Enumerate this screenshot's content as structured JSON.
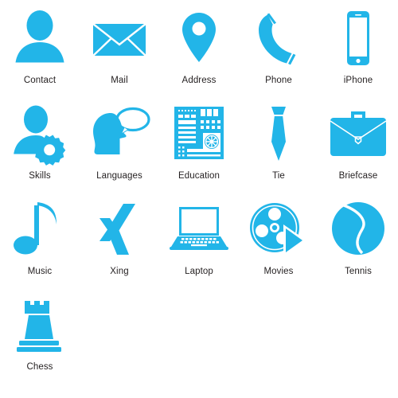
{
  "theme": {
    "icon_color": "#22b5e8",
    "label_color": "#231f20",
    "background_color": "#ffffff"
  },
  "sheet": {
    "columns": 5,
    "rows": 4,
    "total_icons": 16
  },
  "icons": [
    {
      "id": "contact",
      "label": "Contact",
      "glyph": "person-silhouette-icon"
    },
    {
      "id": "mail",
      "label": "Mail",
      "glyph": "envelope-icon"
    },
    {
      "id": "address",
      "label": "Address",
      "glyph": "map-pin-icon"
    },
    {
      "id": "phone",
      "label": "Phone",
      "glyph": "telephone-handset-icon"
    },
    {
      "id": "iphone",
      "label": "iPhone",
      "glyph": "smartphone-icon"
    },
    {
      "id": "skills",
      "label": "Skills",
      "glyph": "person-gear-icon"
    },
    {
      "id": "languages",
      "label": "Languages",
      "glyph": "head-speech-bubble-icon"
    },
    {
      "id": "education",
      "label": "Education",
      "glyph": "circuit-board-icon"
    },
    {
      "id": "tie",
      "label": "Tie",
      "glyph": "necktie-icon"
    },
    {
      "id": "briefcase",
      "label": "Briefcase",
      "glyph": "briefcase-icon"
    },
    {
      "id": "music",
      "label": "Music",
      "glyph": "music-note-icon"
    },
    {
      "id": "xing",
      "label": "Xing",
      "glyph": "xing-logo-icon"
    },
    {
      "id": "laptop",
      "label": "Laptop",
      "glyph": "laptop-icon"
    },
    {
      "id": "movies",
      "label": "Movies",
      "glyph": "film-reel-play-icon"
    },
    {
      "id": "tennis",
      "label": "Tennis",
      "glyph": "tennis-ball-icon"
    },
    {
      "id": "chess",
      "label": "Chess",
      "glyph": "chess-rook-icon"
    }
  ]
}
